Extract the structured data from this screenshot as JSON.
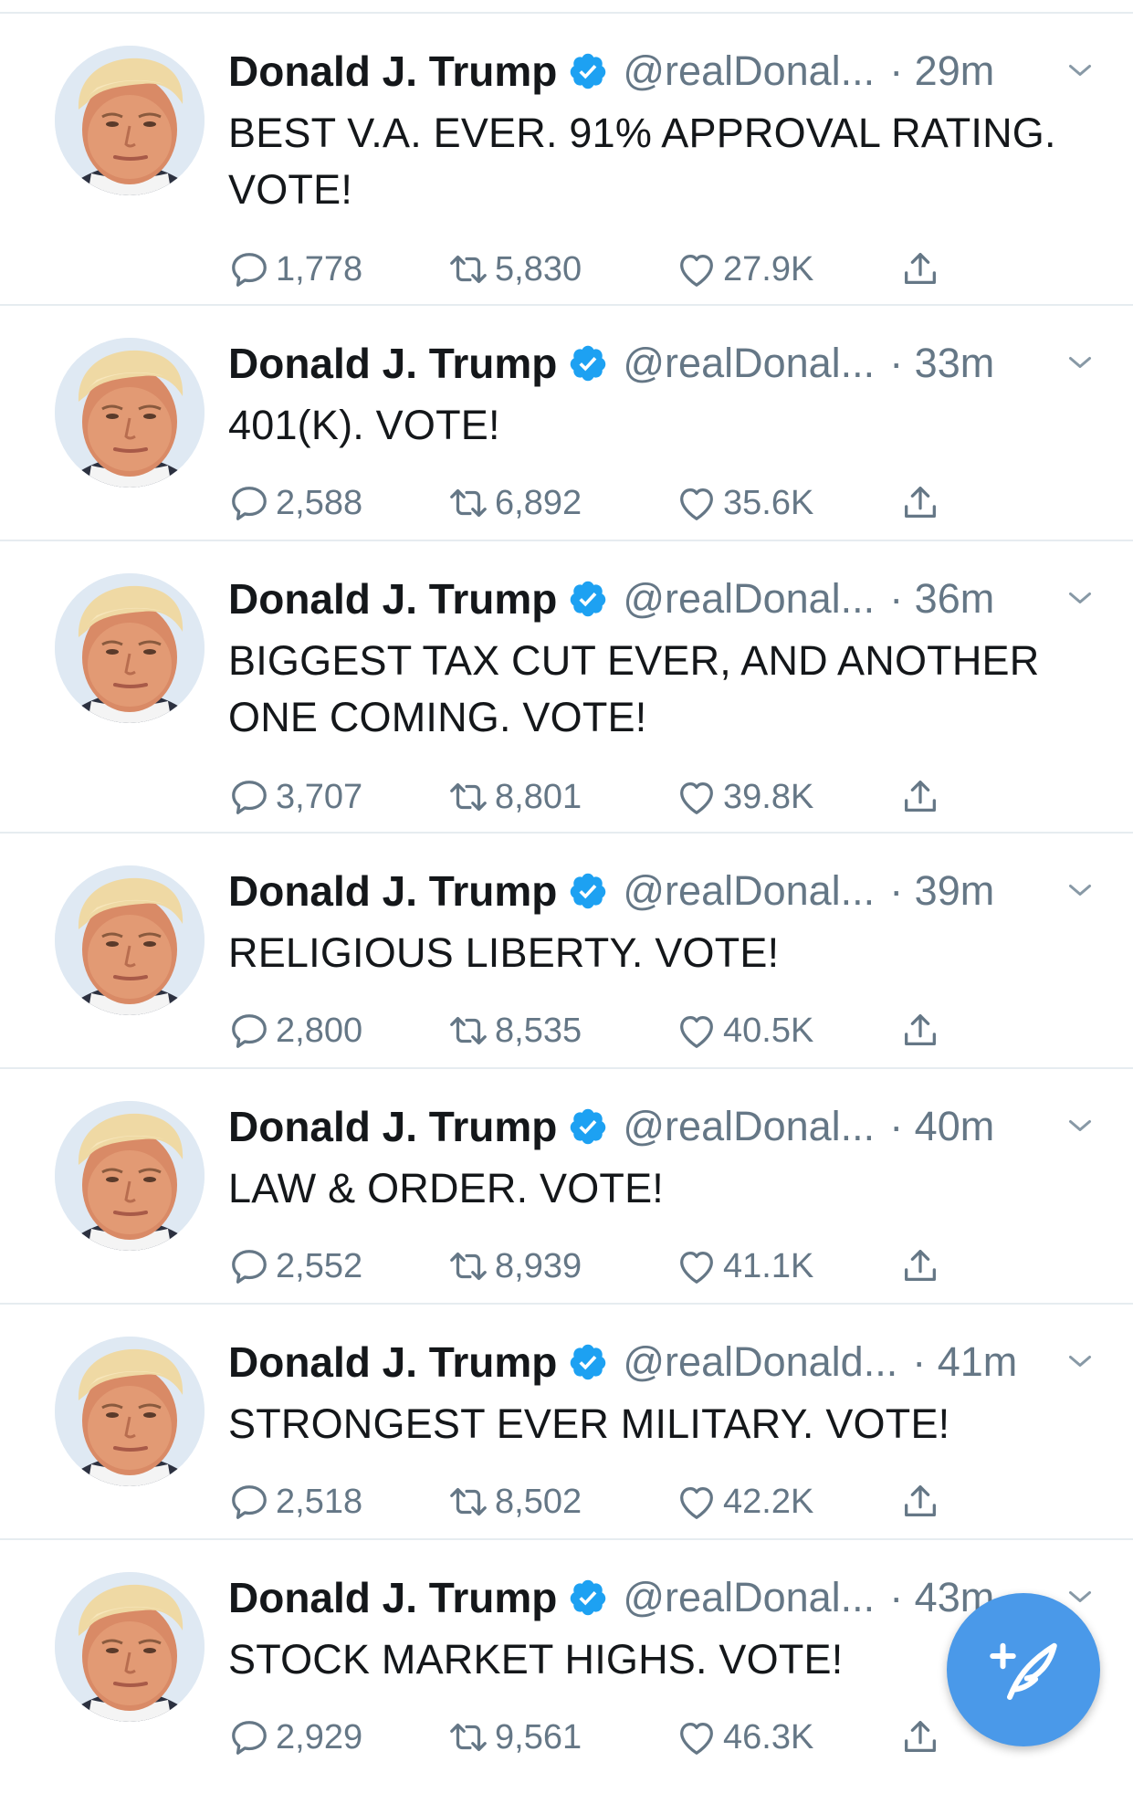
{
  "tweets": [
    {
      "name": "Donald J. Trump",
      "handle": "@realDonal...",
      "time": "· 29m",
      "text": "BEST V.A. EVER. 91% APPROVAL RATING. VOTE!",
      "replies": "1,778",
      "retweets": "5,830",
      "likes": "27.9K"
    },
    {
      "name": "Donald J. Trump",
      "handle": "@realDonal...",
      "time": "· 33m",
      "text": "401(K). VOTE!",
      "replies": "2,588",
      "retweets": "6,892",
      "likes": "35.6K"
    },
    {
      "name": "Donald J. Trump",
      "handle": "@realDonal...",
      "time": "· 36m",
      "text": "BIGGEST TAX CUT EVER, AND ANOTHER ONE COMING. VOTE!",
      "replies": "3,707",
      "retweets": "8,801",
      "likes": "39.8K"
    },
    {
      "name": "Donald J. Trump",
      "handle": "@realDonal...",
      "time": "· 39m",
      "text": "RELIGIOUS LIBERTY. VOTE!",
      "replies": "2,800",
      "retweets": "8,535",
      "likes": "40.5K"
    },
    {
      "name": "Donald J. Trump",
      "handle": "@realDonal...",
      "time": "· 40m",
      "text": "LAW & ORDER. VOTE!",
      "replies": "2,552",
      "retweets": "8,939",
      "likes": "41.1K"
    },
    {
      "name": "Donald J. Trump",
      "handle": "@realDonald...",
      "time": "· 41m",
      "text": "STRONGEST EVER MILITARY. VOTE!",
      "replies": "2,518",
      "retweets": "8,502",
      "likes": "42.2K"
    },
    {
      "name": "Donald J. Trump",
      "handle": "@realDonal...",
      "time": "· 43m",
      "text": "STOCK MARKET HIGHS. VOTE!",
      "replies": "2,929",
      "retweets": "9,561",
      "likes": "46.3K"
    }
  ],
  "icons": {
    "verified": "verified-badge-icon",
    "caret": "chevron-down-icon",
    "reply": "reply-bubble-icon",
    "retweet": "retweet-icon",
    "like": "heart-icon",
    "share": "share-upload-icon",
    "compose": "compose-feather-icon"
  },
  "colors": {
    "accent": "#1da1f2",
    "fab": "#4a99e9",
    "secondary_text": "#657786",
    "primary_text": "#14171a",
    "divider": "#e6ecf0"
  }
}
